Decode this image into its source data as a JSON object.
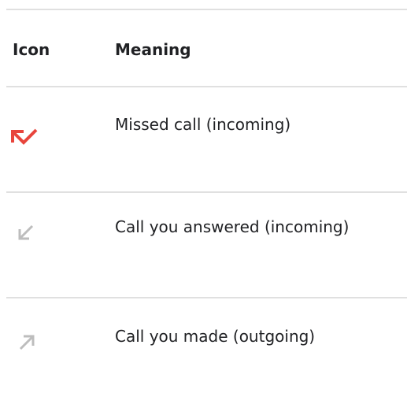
{
  "table": {
    "headers": {
      "icon": "Icon",
      "meaning": "Meaning"
    },
    "rows": [
      {
        "icon": "missed-call-icon",
        "meaning": "Missed call (incoming)",
        "icon_color": "#e8453c"
      },
      {
        "icon": "call-received-icon",
        "meaning": "Call you answered (incoming)",
        "icon_color": "#bdbdbd"
      },
      {
        "icon": "call-made-icon",
        "meaning": "Call you made (outgoing)",
        "icon_color": "#bdbdbd"
      }
    ]
  }
}
